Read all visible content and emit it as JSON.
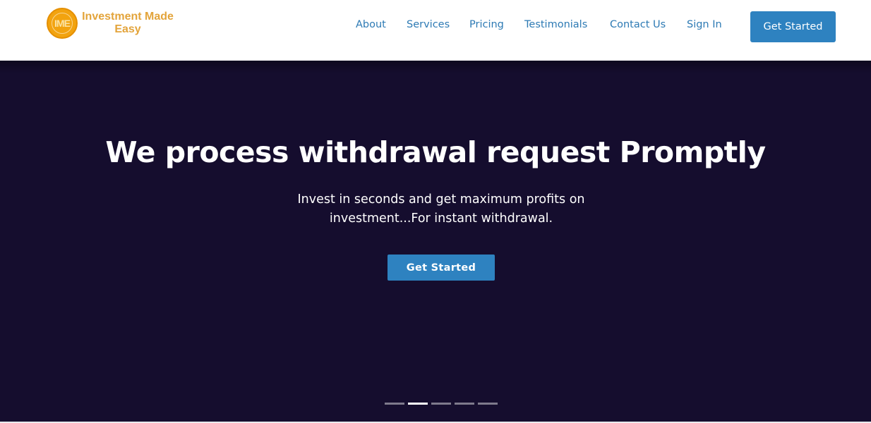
{
  "logo": {
    "monogram": "IME",
    "text_line1": "Investment Made",
    "text_line2": "Easy",
    "colors": {
      "badge": "#f2a30f",
      "text": "#e3a43b"
    }
  },
  "nav": {
    "links": [
      {
        "label": "About"
      },
      {
        "label": "Services"
      },
      {
        "label": "Pricing"
      },
      {
        "label": "Testimonials"
      },
      {
        "label": "Contact Us"
      },
      {
        "label": "Sign In"
      }
    ],
    "cta_label": "Get Started"
  },
  "hero": {
    "title": "We process withdrawal request Promptly",
    "subtitle": "Invest in seconds and get maximum profits on investment...For instant withdrawal.",
    "cta_label": "Get Started",
    "slides": {
      "count": 5,
      "active_index": 1
    }
  },
  "colors": {
    "accent": "#2e82c0",
    "hero_background": "#150d2e",
    "nav_link": "#2d7ab4"
  }
}
